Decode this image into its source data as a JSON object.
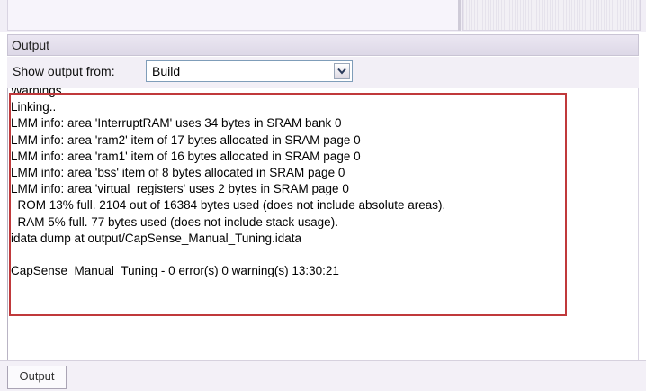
{
  "panel": {
    "title": "Output",
    "toolbar": {
      "show_output_label": "Show output from:",
      "selected_source": "Build"
    },
    "log_lines": [
      "Warnings",
      "Linking..",
      "LMM info: area 'InterruptRAM' uses 34 bytes in SRAM bank 0",
      "LMM info: area 'ram2' item of 17 bytes allocated in SRAM page 0",
      "LMM info: area 'ram1' item of 16 bytes allocated in SRAM page 0",
      "LMM info: area 'bss' item of 8 bytes allocated in SRAM page 0",
      "LMM info: area 'virtual_registers' uses 2 bytes in SRAM page 0",
      "  ROM 13% full. 2104 out of 16384 bytes used (does not include absolute areas).",
      "  RAM 5% full. 77 bytes used (does not include stack usage).",
      "idata dump at output/CapSense_Manual_Tuning.idata",
      "",
      "CapSense_Manual_Tuning - 0 error(s) 0 warning(s) 13:30:21"
    ],
    "bottom_tab": "Output"
  },
  "colors": {
    "highlight_frame": "#c0393b",
    "panel_bg": "#f2eff6"
  }
}
